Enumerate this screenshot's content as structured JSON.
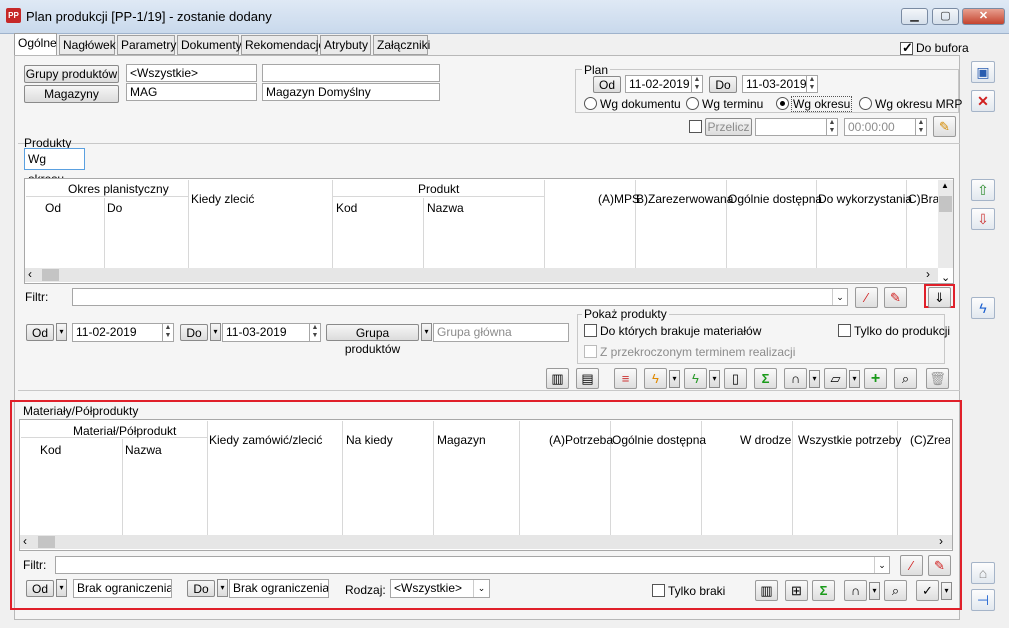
{
  "window": {
    "app_icon": "PP",
    "title": "Plan produkcji [PP-1/19] - zostanie dodany"
  },
  "tabs": [
    "Ogólne",
    "Nagłówek",
    "Parametry",
    "Dokumenty",
    "Rekomendacje",
    "Atrybuty",
    "Załączniki"
  ],
  "do_bufora": "Do bufora",
  "grupy_produktow": {
    "button": "Grupy produktów",
    "value": "<Wszystkie>",
    "value2": ""
  },
  "magazyny": {
    "button": "Magazyny",
    "code": "MAG",
    "name": "Magazyn Domyślny"
  },
  "plan": {
    "title": "Plan",
    "od_label": "Od",
    "od_value": "11-02-2019",
    "do_label": "Do",
    "do_value": "11-03-2019",
    "radios": [
      "Wg dokumentu",
      "Wg terminu",
      "Wg okresu",
      "Wg okresu MRP"
    ],
    "przelicz": "Przelicz",
    "time": "00:00:00"
  },
  "produkty": {
    "title": "Produkty",
    "subtab": "Wg okresu",
    "headers": {
      "okres": "Okres planistyczny",
      "od": "Od",
      "do": "Do",
      "kiedy": "Kiedy zlecić",
      "produkt": "Produkt",
      "kod": "Kod",
      "nazwa": "Nazwa",
      "mps": "(A)MPS",
      "zarezerw": "B)Zarezerwowana",
      "ogolnie": "Ogólnie dostępna",
      "do_wyk": "Do wykorzystania",
      "braki": "C)Braki"
    },
    "filtr": "Filtr:",
    "od_label": "Od",
    "od_value": "11-02-2019",
    "do_label": "Do",
    "do_value": "11-03-2019",
    "grupa_button": "Grupa produktów",
    "grupa_value": "Grupa główna",
    "pokaz": {
      "title": "Pokaż produkty",
      "brakuje": "Do których brakuje materiałów",
      "tylko": "Tylko do produkcji",
      "przekroczony": "Z przekroczonym terminem realizacji"
    }
  },
  "materialy": {
    "title": "Materiały/Półprodukty",
    "headers": {
      "matpol": "Materiał/Półprodukt",
      "kod": "Kod",
      "nazwa": "Nazwa",
      "kiedy": "Kiedy zamówić/zlecić",
      "na_kiedy": "Na kiedy",
      "magazyn": "Magazyn",
      "potrzeba": "(A)Potrzeba",
      "ogolnie": "Ogólnie dostępna",
      "w_drodze": "W drodze",
      "wszystkie": "Wszystkie potrzeby",
      "zreal": "(C)Zreal"
    },
    "filtr": "Filtr:",
    "od_label": "Od",
    "od_value": "Brak ograniczenia",
    "do_label": "Do",
    "do_value": "Brak ograniczenia",
    "rodzaj_label": "Rodzaj:",
    "rodzaj_value": "<Wszystkie>",
    "tylko_braki": "Tylko braki"
  },
  "colors": {
    "highlight": "#e0202a",
    "accent": "#3399ff"
  }
}
